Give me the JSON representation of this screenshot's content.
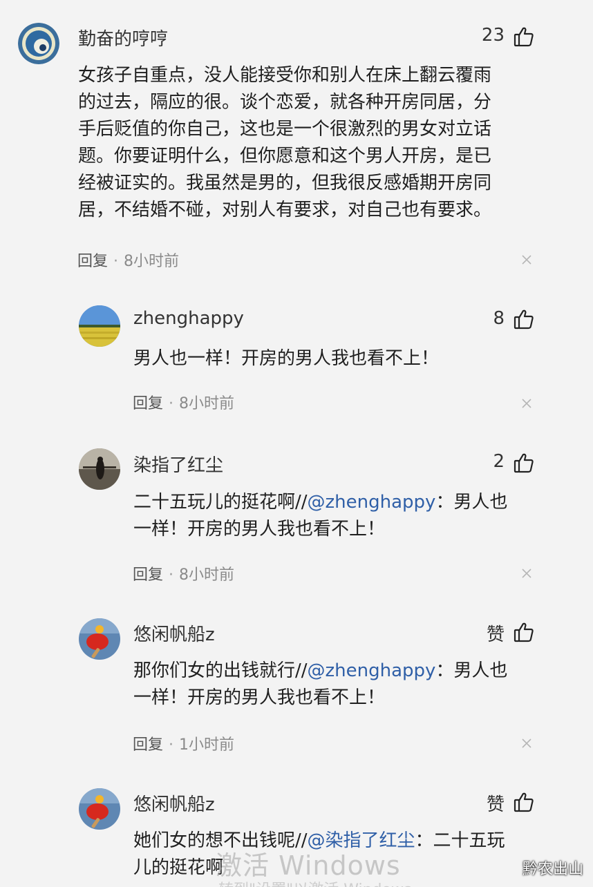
{
  "comments": [
    {
      "username": "勤奋的哼哼",
      "likes": "23",
      "lines": [
        "女孩子自重点，没人能接受你和别人在床上翻云覆雨",
        "的过去，隔应的很。谈个恋爱，就各种开房同居，分",
        "手后贬值的你自己，这也是一个很激烈的男女对立话",
        "题。你要证明什么，但你愿意和这个男人开房，是已",
        "经被证实的。我虽然是男的，但我很反感婚期开房同",
        "居，不结婚不碰，对别人有要求，对自己也有要求。"
      ],
      "reply_label": "回复",
      "dot": "·",
      "time": "8小时前"
    },
    {
      "username": "zhenghappy",
      "likes": "8",
      "lines": [
        "男人也一样！开房的男人我也看不上！"
      ],
      "reply_label": "回复",
      "dot": "·",
      "time": "8小时前"
    },
    {
      "username": "染指了红尘",
      "likes": "2",
      "line1_prefix": "二十五玩儿的挺花啊//",
      "line1_mention": "@zhenghappy",
      "line1_suffix": "：男人也",
      "line2": "一样！开房的男人我也看不上！",
      "reply_label": "回复",
      "dot": "·",
      "time": "8小时前"
    },
    {
      "username": "悠闲帆船z",
      "likes": "赞",
      "line1_prefix": "那你们女的出钱就行//",
      "line1_mention": "@zhenghappy",
      "line1_suffix": "：男人也",
      "line2": "一样！开房的男人我也看不上！",
      "reply_label": "回复",
      "dot": "·",
      "time": "1小时前"
    },
    {
      "username": "悠闲帆船z",
      "likes": "赞",
      "line1_prefix": "她们女的想不出钱呢//",
      "line1_mention": "@染指了红尘",
      "line1_suffix": "：二十五玩",
      "line2": "儿的挺花啊"
    }
  ],
  "watermark": {
    "line1": "激活 Windows",
    "line2": "转到\"设置\"以激活 Windows"
  },
  "site_mark": "黔农出山",
  "colors": {
    "background": "#f3f3f3",
    "mention": "#2f5fa7",
    "meta_time": "#8a8a8a"
  }
}
